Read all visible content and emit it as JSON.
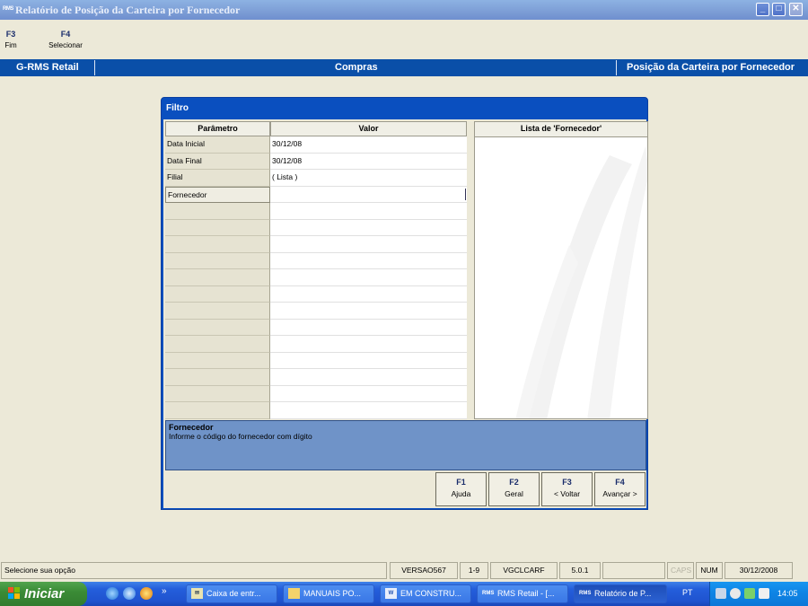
{
  "window": {
    "app_icon": "RMS",
    "title": "Relatório de Posição da Carteira por Fornecedor",
    "controls": {
      "minimize": "_",
      "maximize": "□",
      "close": "✕"
    }
  },
  "toolbar": {
    "keys": [
      {
        "key": "F3",
        "label": "Fim"
      },
      {
        "key": "F4",
        "label": "Selecionar"
      }
    ]
  },
  "header": {
    "left": "G-RMS Retail",
    "center": "Compras",
    "right": "Posição da Carteira por Fornecedor"
  },
  "dialog": {
    "title": "Filtro",
    "table": {
      "headers": [
        "Parâmetro",
        "Valor"
      ],
      "rows": [
        {
          "param": "Data Inicial",
          "value": "30/12/08"
        },
        {
          "param": "Data Final",
          "value": "30/12/08"
        },
        {
          "param": "Filial",
          "value": "( Lista )"
        },
        {
          "param": "Fornecedor",
          "value": ""
        },
        {
          "param": "",
          "value": ""
        },
        {
          "param": "",
          "value": ""
        },
        {
          "param": "",
          "value": ""
        },
        {
          "param": "",
          "value": ""
        },
        {
          "param": "",
          "value": ""
        },
        {
          "param": "",
          "value": ""
        },
        {
          "param": "",
          "value": ""
        },
        {
          "param": "",
          "value": ""
        },
        {
          "param": "",
          "value": ""
        },
        {
          "param": "",
          "value": ""
        },
        {
          "param": "",
          "value": ""
        },
        {
          "param": "",
          "value": ""
        },
        {
          "param": "",
          "value": ""
        }
      ],
      "selected_row": 3
    },
    "list_header": "Lista de 'Fornecedor'",
    "help": {
      "title": "Fornecedor",
      "text": "Informe o código do fornecedor com dígito"
    },
    "buttons": [
      {
        "key": "F1",
        "label": "Ajuda",
        "accel": "j"
      },
      {
        "key": "F2",
        "label": "Geral",
        "accel": "G"
      },
      {
        "key": "F3",
        "label": "< Voltar",
        "accel": "V"
      },
      {
        "key": "F4",
        "label": "Avançar >",
        "accel": "A"
      }
    ]
  },
  "statusbar": {
    "message": "Selecione sua opção",
    "version": "VERSAO567",
    "range": "1-9",
    "program": "VGCLCARF",
    "release": "5.0.1",
    "blank": "",
    "caps": "CAPS",
    "num": "NUM",
    "date": "30/12/2008"
  },
  "taskbar": {
    "start_label": "Iniciar",
    "overflow": "»",
    "items": [
      {
        "label": "Caixa de entr...",
        "icon": "mail-icon"
      },
      {
        "label": "MANUAIS PO...",
        "icon": "folder-icon"
      },
      {
        "label": "EM CONSTRU...",
        "icon": "word-icon"
      },
      {
        "label": "RMS Retail - [...",
        "icon": "rms-icon"
      },
      {
        "label": "Relatório de P...",
        "icon": "rms-icon"
      }
    ],
    "lang": "PT",
    "clock": "14:05"
  },
  "colors": {
    "header_blue": "#0a4fa8",
    "dialog_blue": "#0a4fbf",
    "help_blue": "#6f93c8",
    "taskbar_blue": "#245edb",
    "start_green": "#3b8c36"
  }
}
